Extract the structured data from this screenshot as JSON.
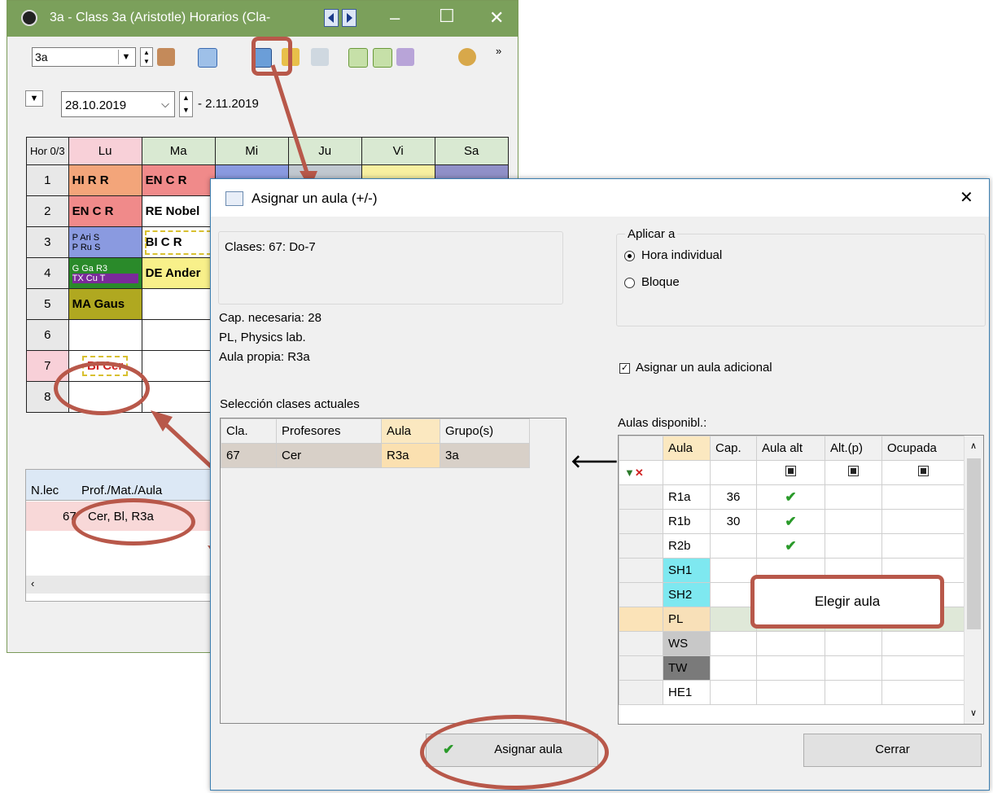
{
  "back_window": {
    "title": "3a - Class 3a (Aristotle)  Horarios  (Cla-",
    "class_combo": "3a",
    "date_from": "28.10.2019",
    "date_to": "- 2.11.2019",
    "timetable": {
      "corner": "Hor 0/3",
      "days": [
        "Lu",
        "Ma",
        "Mi",
        "Ju",
        "Vi",
        "Sa"
      ],
      "periods": [
        "1",
        "2",
        "3",
        "4",
        "5",
        "6",
        "7",
        "8"
      ],
      "cells": {
        "r1_lu": "HI R R",
        "r1_ma": "EN C R",
        "r2_lu": "EN C R",
        "r2_ma": "RE Nobel",
        "r3_lu_a": "P Ari S",
        "r3_lu_b": "P Ru S",
        "r3_ma": "BI C R",
        "r4_lu_a": "G Ga R3",
        "r4_lu_b": "TX Cu T",
        "r4_ma": "DE Ander",
        "r5_lu": "MA Gaus",
        "r7_lu": "BI Cer"
      }
    },
    "lesson_list": {
      "headers": [
        "N.lec",
        "Prof./Mat./Aula"
      ],
      "row": {
        "num": "67",
        "desc": "Cer, Bl, R3a"
      }
    }
  },
  "dialog": {
    "title": "Asignar un aula (+/-)",
    "close": "✕",
    "classes_text": "Clases: 67: Do-7",
    "info_lines": [
      "Cap. necesaria: 28",
      "PL, Physics lab.",
      "Aula propia: R3a"
    ],
    "apply_to": {
      "legend": "Aplicar a",
      "options": [
        "Hora individual",
        "Bloque"
      ],
      "selected": "Hora individual"
    },
    "additional_room_label": "Asignar un aula adicional",
    "current_selection": {
      "heading": "Selección clases actuales",
      "headers": [
        "Cla.",
        "Profesores",
        "Aula",
        "Grupo(s)"
      ],
      "row": [
        "67",
        "Cer",
        "R3a",
        "3a"
      ]
    },
    "available_rooms": {
      "heading": "Aulas disponibl.:",
      "headers": [
        "Aula",
        "Cap.",
        "Aula alt",
        "Alt.(p)",
        "Ocupada"
      ],
      "rows": [
        {
          "aula": "R1a",
          "cap": "36",
          "alt": true
        },
        {
          "aula": "R1b",
          "cap": "30",
          "alt": true
        },
        {
          "aula": "R2b",
          "cap": "",
          "alt": true
        },
        {
          "aula": "SH1",
          "cap": "",
          "alt": false
        },
        {
          "aula": "SH2",
          "cap": "",
          "alt": false
        },
        {
          "aula": "PL",
          "cap": "",
          "alt": false
        },
        {
          "aula": "WS",
          "cap": "",
          "alt": false
        },
        {
          "aula": "TW",
          "cap": "",
          "alt": false
        },
        {
          "aula": "HE1",
          "cap": "",
          "alt": false
        }
      ]
    },
    "callout": "Elegir aula",
    "assign_button": "Asignar aula",
    "close_button": "Cerrar",
    "arrow_glyph": "🡐"
  },
  "colors": {
    "title_green": "#7ba05b",
    "accent_red": "#b8584a"
  }
}
